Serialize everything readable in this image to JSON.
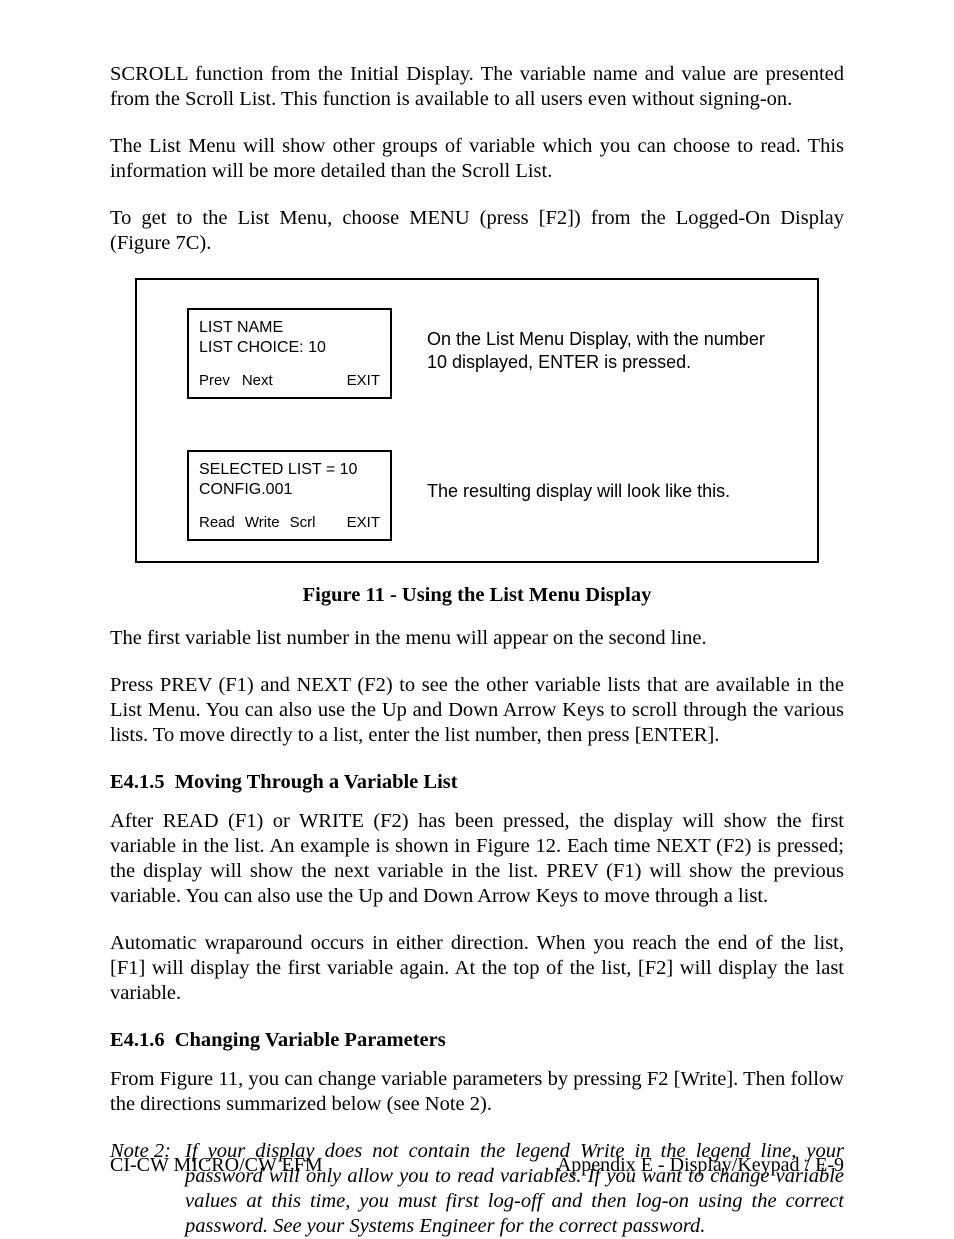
{
  "p1": "SCROLL function from the Initial Display. The variable name and value are presented from the Scroll List. This function is available to all users even without signing-on.",
  "p2": "The List Menu will show other groups of variable which you can choose to read. This information will be more detailed than the Scroll List.",
  "p3": "To get to the List Menu, choose MENU (press [F2]) from the Logged-On Display (Figure 7C).",
  "lcd1": {
    "l1": "LIST NAME",
    "l2": "LIST CHOICE: 10",
    "b1": "Prev",
    "b2": "Next",
    "b3": "EXIT"
  },
  "annot1": "On the List Menu Display, with the number 10 displayed, ENTER is pressed.",
  "lcd2": {
    "l1": "SELECTED LIST = 10",
    "l2": "CONFIG.001",
    "b1": "Read",
    "b2": "Write",
    "b3": "Scrl",
    "b4": "EXIT"
  },
  "annot2": "The resulting display will look like this.",
  "caption": "Figure 11 - Using the List Menu Display",
  "p4": "The first variable list number in the menu will appear on the second line.",
  "p5": "Press PREV (F1) and NEXT (F2) to see the other variable lists that are available in the List Menu. You can also use the Up and Down Arrow Keys to scroll through the various lists. To move directly to a list, enter the list number, then press [ENTER].",
  "h1no": "E4.1.5",
  "h1": "Moving Through a Variable List",
  "p6": "After READ (F1) or WRITE (F2) has been pressed, the display will show the first variable in the list. An example is shown in Figure 12. Each time NEXT (F2) is pressed; the display will show the next variable in the list. PREV (F1) will show the previous variable. You can also use the Up and Down Arrow Keys to move through a list.",
  "p7": "Automatic wraparound occurs in either direction. When you reach the end of the list, [F1] will display the first variable again. At the top of the list, [F2] will display the last variable.",
  "h2no": "E4.1.6",
  "h2": "Changing Variable Parameters",
  "p8": "From Figure 11, you can change variable parameters by pressing F2 [Write]. Then follow the directions summarized below (see Note 2).",
  "noteLabel": "Note 2:",
  "noteBody": "If your display does not contain the legend Write in the legend line, your password will only allow you to read variables. If you want to change variable values at this time, you must first log-off and then log-on using the correct password. See your Systems Engineer for the correct password.",
  "footerLeft": "CI-CW MICRO/CW EFM",
  "footerRight": "Appendix E - Display/Keypad / E-9"
}
